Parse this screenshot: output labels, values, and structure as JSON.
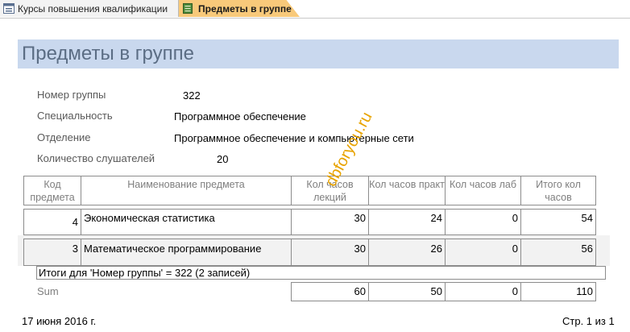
{
  "tabs": [
    {
      "label": "Курсы повышения квалификации",
      "icon": "form-icon"
    },
    {
      "label": "Предметы в группе",
      "icon": "report-icon"
    }
  ],
  "report": {
    "title": "Предметы в группе",
    "fields": [
      {
        "label": "Номер группы",
        "value": "322"
      },
      {
        "label": "Специальность",
        "value": "Программное обеспечение"
      },
      {
        "label": "Отделение",
        "value": "Программное обеспечение и компьютерные сети"
      },
      {
        "label": "Количество слушателей",
        "value": "20"
      }
    ],
    "columns": [
      "Код предмета",
      "Наименование предмета",
      "Кол часов лекций",
      "Кол часов практ",
      "Кол часов лаб",
      "Итого кол часов"
    ],
    "rows": [
      {
        "code": "4",
        "name": "Экономическая статистика",
        "lect": "30",
        "pract": "24",
        "lab": "0",
        "total": "54"
      },
      {
        "code": "3",
        "name": "Математическое программирование",
        "lect": "30",
        "pract": "26",
        "lab": "0",
        "total": "56"
      }
    ],
    "summary_text": "Итоги для 'Номер группы' =  322 (2 записей)",
    "sum_label": "Sum",
    "sums": {
      "lect": "60",
      "pract": "50",
      "lab": "0",
      "total": "110"
    },
    "footer_date": "17 июня 2016 г.",
    "footer_page": "Стр. 1 из 1",
    "watermark": "dbforyou.ru"
  },
  "colors": {
    "title_band": "#c9d8ee",
    "active_tab": "#f8c97a",
    "title_text": "#5b6d84",
    "watermark": "#e8a300"
  }
}
